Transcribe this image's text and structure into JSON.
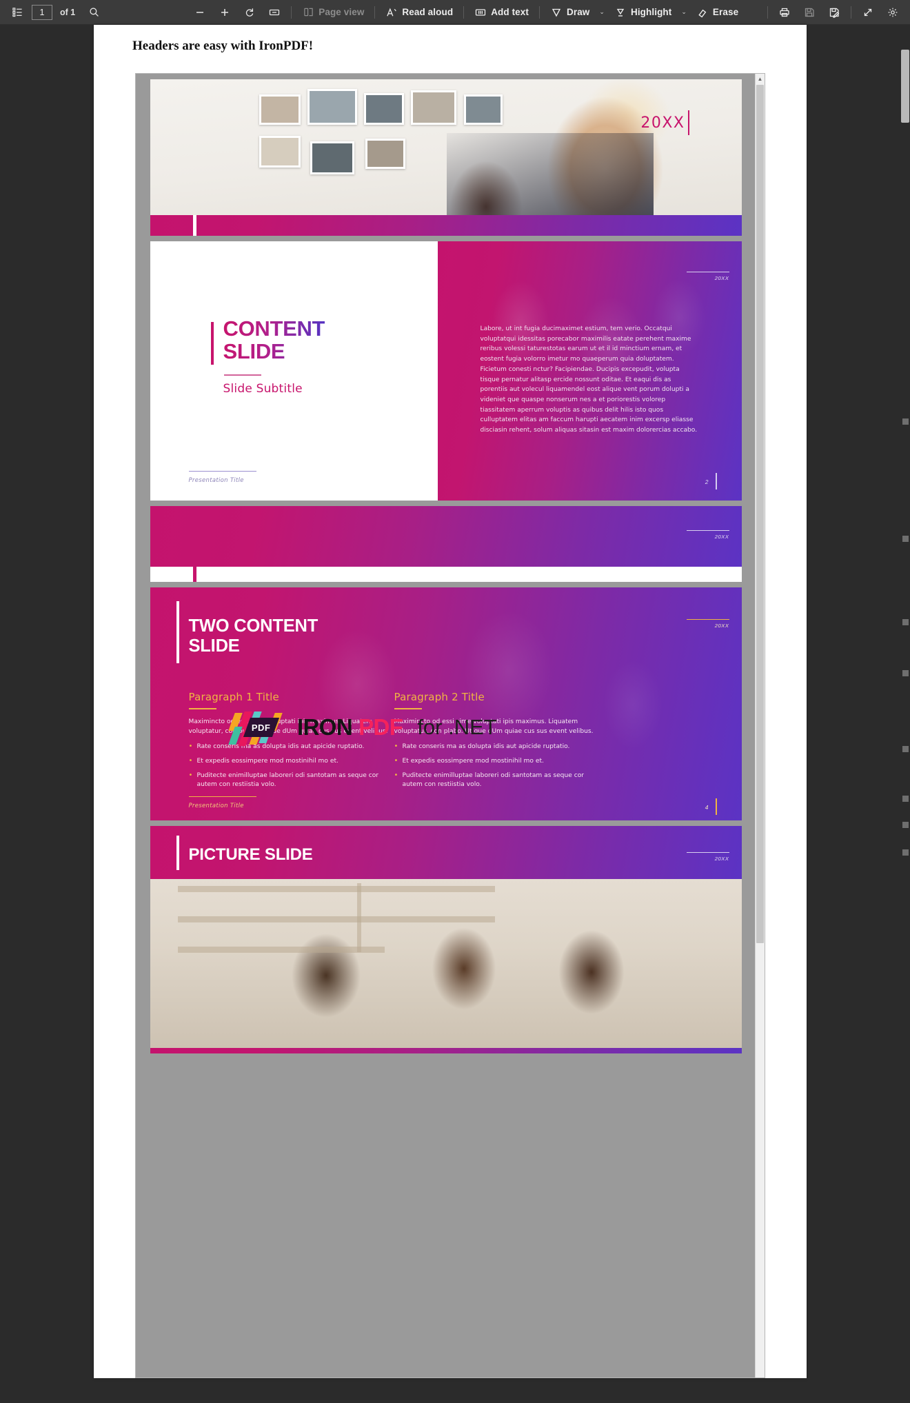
{
  "toolbar": {
    "thumbnails_icon": "list-thumbnails-icon",
    "page_number": "1",
    "page_total": "of 1",
    "search_icon": "search-icon",
    "zoom_out_icon": "minus-icon",
    "zoom_in_icon": "plus-icon",
    "rotate_icon": "rotate-icon",
    "fit_icon": "fit-page-icon",
    "page_view_label": "Page view",
    "page_view_icon": "page-view-icon",
    "read_aloud_label": "Read aloud",
    "read_aloud_icon": "read-aloud-icon",
    "add_text_label": "Add text",
    "add_text_icon": "add-text-icon",
    "draw_label": "Draw",
    "draw_icon": "draw-pen-icon",
    "highlight_label": "Highlight",
    "highlight_icon": "highlighter-icon",
    "erase_label": "Erase",
    "erase_icon": "eraser-icon",
    "print_icon": "print-icon",
    "save_icon": "save-icon",
    "save_as_icon": "save-as-icon",
    "fullscreen_icon": "fullscreen-icon",
    "settings_icon": "gear-icon",
    "caret": "⌄"
  },
  "document": {
    "header_text": "Headers are easy with IronPDF!"
  },
  "watermark": {
    "badge": "PDF",
    "word_iron": "IRON",
    "word_pdf": "PDF",
    "suffix": "for .NET"
  },
  "slides": {
    "slide1": {
      "year": "20XX"
    },
    "slide2": {
      "title_line1": "CONTENT",
      "title_line2": "SLIDE",
      "subtitle": "Slide Subtitle",
      "year": "20XX",
      "body": "Labore, ut int fugia ducimaximet estium, tem verio. Occatqui voluptatqui idessitas porecabor maximilis eatate perehent maxime reribus volessi taturestotas earum ut et il id minctium ernam, et eostent fugia volorro imetur mo quaeperum quia doluptatem. Ficietum conesti nctur? Facipiendae. Ducipis excepudit, volupta tisque pernatur alitasp ercide nossunt oditae. Et eaqui dis as porentiis aut volecul liquamendel eost alique vent porum dolupti a videniet que quaspe nonserum nes a et poriorestis volorep tiassitatem aperrum voluptis as quibus delit hilis isto quos culluptatem elitas am faccum harupti aecatem inim excersp eliasse disciasin rehent, solum aliquas sitasin est maxim dolorercias accabo.",
      "footer": "Presentation Title",
      "number": "2"
    },
    "slide3": {
      "year": "20XX"
    },
    "slide4": {
      "title_line1": "TWO CONTENT",
      "title_line2": "SLIDE",
      "year": "20XX",
      "footer": "Presentation Title",
      "number": "4",
      "columns": [
        {
          "title": "Paragraph 1 Title",
          "body": "Maximincto od essi sime voluptati ipis maximus. Liquatem voluptatur, con plabo. Ut que dUm quiae cus sus event velibus.",
          "bullets": [
            "Rate conseris ma as dolupta idis aut apicide ruptatio.",
            "Et expedis eossimpere mod mostinihil mo et.",
            "Puditecte enimilluptae laboreri odi santotam as seque cor autem con restiistia volo."
          ]
        },
        {
          "title": "Paragraph 2 Title",
          "body": "Maximincto od essi sime voluptati ipis maximus. Liquatem voluptatur, con plabo. Ut que dUm quiae cus sus event velibus.",
          "bullets": [
            "Rate conseris ma as dolupta idis aut apicide ruptatio.",
            "Et expedis eossimpere mod mostinihil mo et.",
            "Puditecte enimilluptae laboreri odi santotam as seque cor autem con restiistia volo."
          ]
        }
      ]
    },
    "slide5": {
      "title": "PICTURE SLIDE",
      "year": "20XX"
    }
  },
  "colors": {
    "accent_pink": "#c7146c",
    "accent_purple": "#5b33c4",
    "accent_gold": "#f0b542",
    "toolbar_bg": "#3b3b3b",
    "app_bg": "#2b2b2b"
  }
}
